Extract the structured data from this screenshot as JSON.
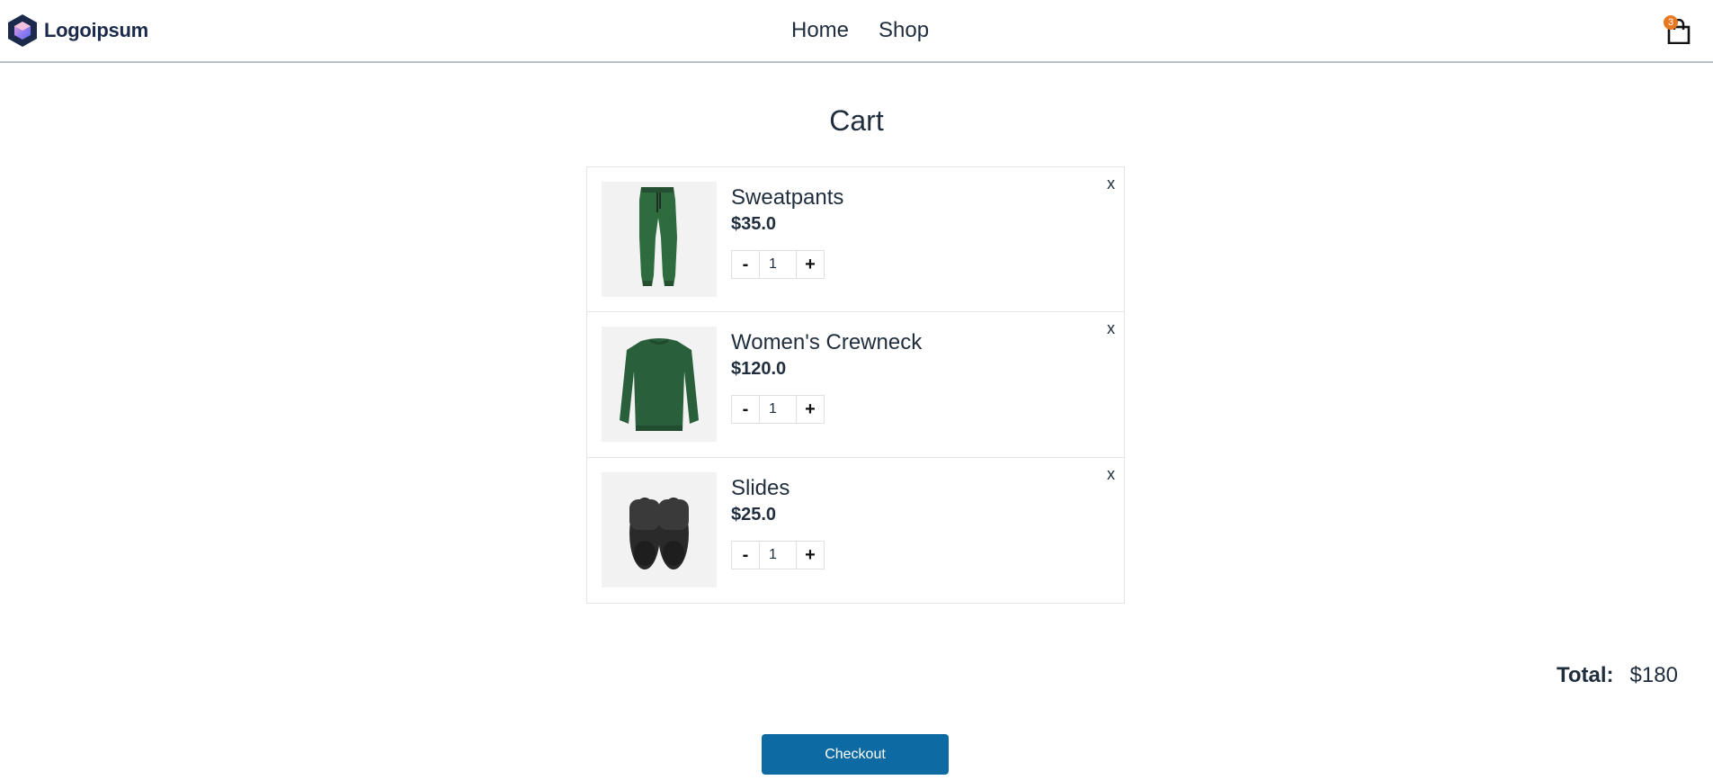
{
  "header": {
    "logo_text": "Logoipsum",
    "nav": [
      {
        "label": "Home"
      },
      {
        "label": "Shop"
      }
    ],
    "cart_count": "3",
    "icons": {
      "logo": "hexagon-logo-icon",
      "cart": "shopping-bag-icon"
    },
    "colors": {
      "badge": "#e87722",
      "logo_text": "#1b2a4a"
    }
  },
  "page": {
    "title": "Cart"
  },
  "cart": {
    "items": [
      {
        "name": "Sweatpants",
        "price": "$35.0",
        "quantity": "1",
        "remove_label": "x",
        "decrement_label": "-",
        "increment_label": "+",
        "image": "green-sweatpants"
      },
      {
        "name": "Women's Crewneck",
        "price": "$120.0",
        "quantity": "1",
        "remove_label": "x",
        "decrement_label": "-",
        "increment_label": "+",
        "image": "green-crewneck"
      },
      {
        "name": "Slides",
        "price": "$25.0",
        "quantity": "1",
        "remove_label": "x",
        "decrement_label": "-",
        "increment_label": "+",
        "image": "black-slides"
      }
    ],
    "total_label": "Total:",
    "total_value": "$180",
    "checkout_label": "Checkout",
    "colors": {
      "checkout_button": "#0e6aa3"
    }
  }
}
